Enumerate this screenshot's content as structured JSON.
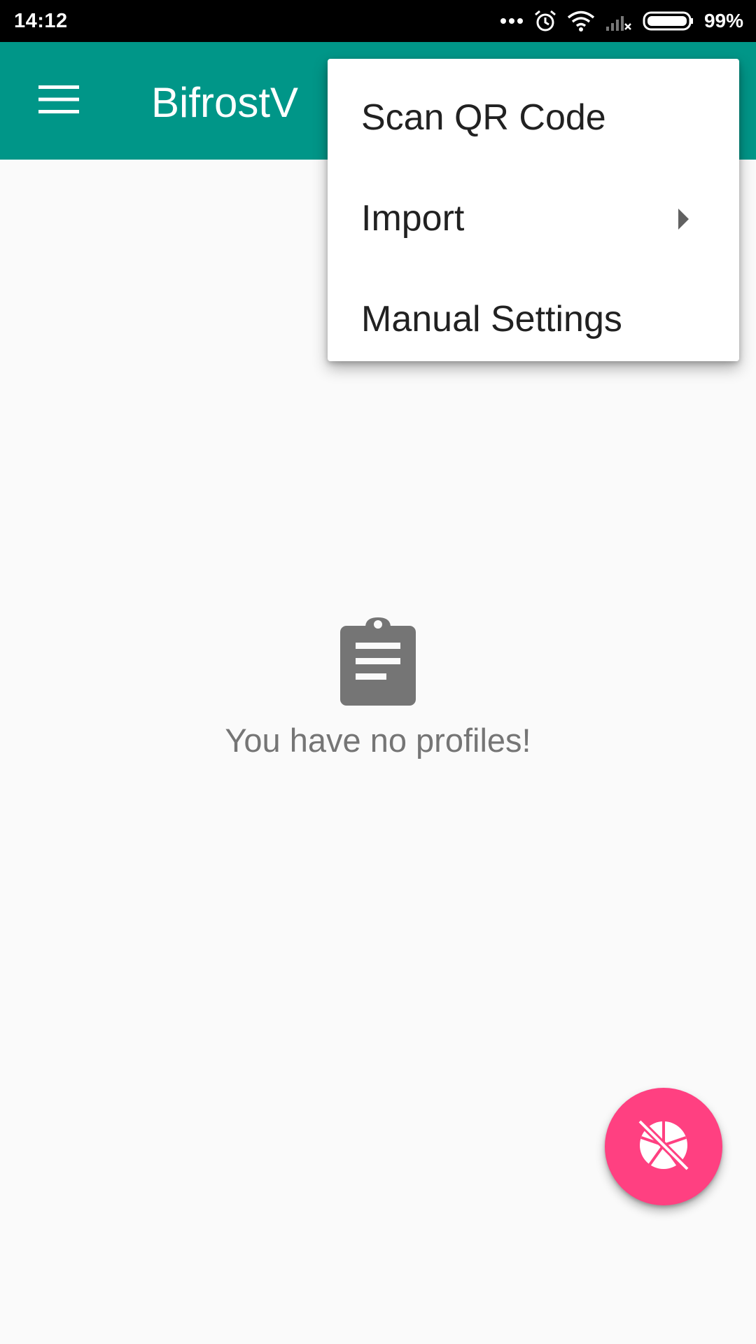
{
  "status_bar": {
    "time": "14:12",
    "battery_percent": "99%",
    "icons": [
      "more-dots-icon",
      "alarm-icon",
      "wifi-icon",
      "signal-no-service-icon",
      "battery-icon"
    ]
  },
  "app_bar": {
    "title": "BifrostV",
    "nav_icon": "hamburger-menu-icon",
    "color": "#009688"
  },
  "empty_state": {
    "icon": "clipboard-icon",
    "message": "You have no profiles!"
  },
  "overflow_menu": {
    "items": [
      {
        "label": "Scan QR Code",
        "has_submenu": false
      },
      {
        "label": "Import",
        "has_submenu": true
      },
      {
        "label": "Manual Settings",
        "has_submenu": false
      }
    ]
  },
  "fab": {
    "icon": "shutter-off-icon",
    "color": "#ff4081"
  }
}
